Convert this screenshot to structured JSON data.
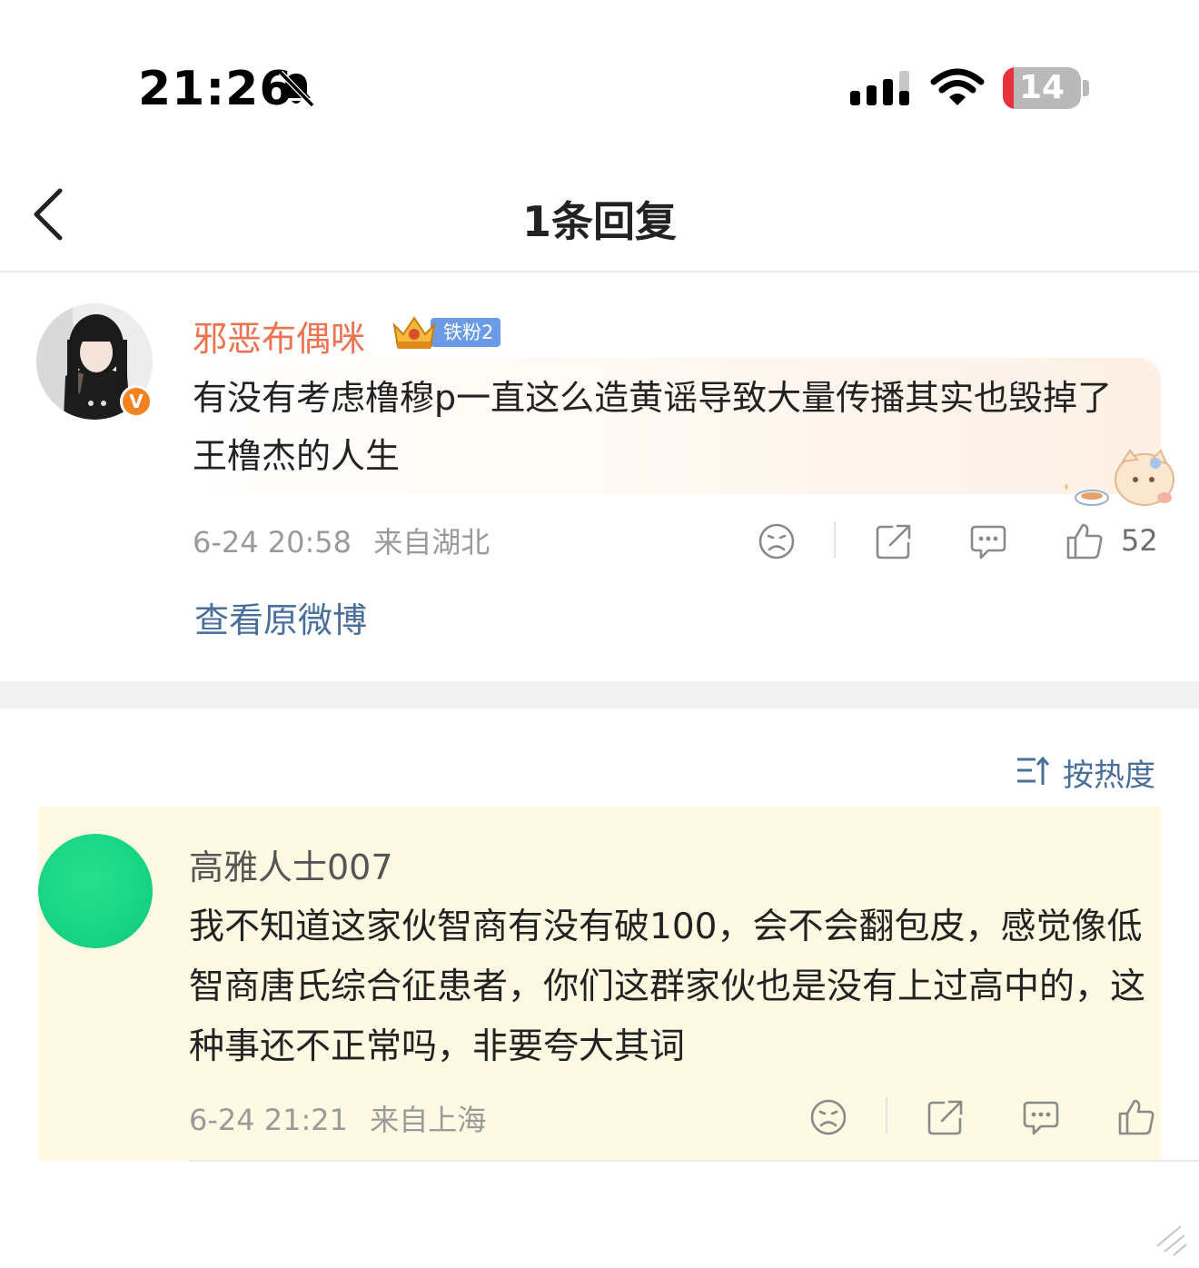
{
  "status_bar": {
    "time": "21:26",
    "battery_level": "14",
    "battery_fraction": 0.14,
    "icons": [
      "bell-muted-icon",
      "signal-icon",
      "wifi-icon",
      "battery-icon"
    ]
  },
  "nav": {
    "title": "1条回复",
    "back_icon": "chevron-left-icon"
  },
  "original_comment": {
    "username": "邪恶布偶咪",
    "verified_badge": "V",
    "fan_badge": "铁粉2",
    "text": "有没有考虑橹穆p一直这么造黄谣导致大量传播其实也毁掉了王橹杰的人生",
    "time": "6-24 20:58",
    "location": "来自湖北",
    "like_count": "52",
    "view_original_link": "查看原微博",
    "colors": {
      "username": "#eb7350",
      "link": "#4a6f9a"
    }
  },
  "sort": {
    "label": "按热度",
    "icon": "sort-icon"
  },
  "replies": [
    {
      "username": "高雅人士007",
      "text": "我不知道这家伙智商有没有破100，会不会翻包皮，感觉像低智商唐氏综合征患者，你们这群家伙也是没有上过高中的，这种事还不正常吗，非要夸大其词",
      "time": "6-24 21:21",
      "location": "来自上海",
      "avatar_color": "#17d483",
      "highlight_color": "#fdf9e2"
    }
  ]
}
